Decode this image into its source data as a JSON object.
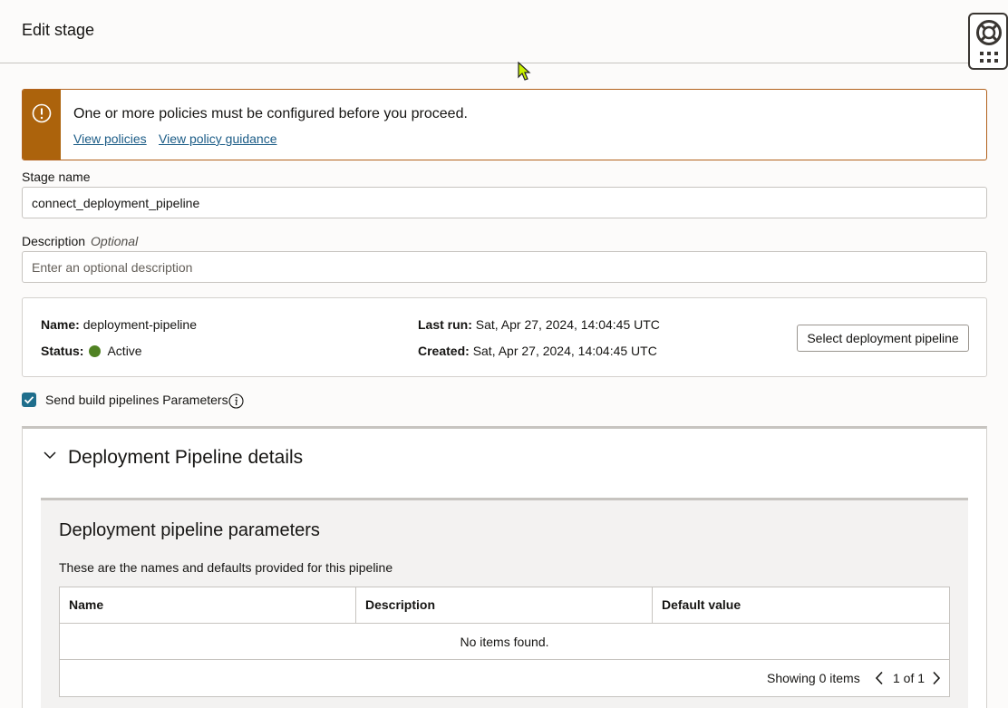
{
  "header": {
    "title": "Edit stage"
  },
  "help_widget": {
    "icon": "lifebuoy-icon",
    "menu_icon": "apps-grid-icon"
  },
  "alert": {
    "message": "One or more policies must be configured before you proceed.",
    "links": [
      "View policies",
      "View policy guidance"
    ],
    "color": "#ac630c"
  },
  "form": {
    "stage_name_label": "Stage name",
    "stage_name_value": "connect_deployment_pipeline",
    "description_label": "Description",
    "description_optional": "Optional",
    "description_placeholder": "Enter an optional description"
  },
  "pipeline": {
    "name_label": "Name:",
    "name_value": "deployment-pipeline",
    "status_label": "Status:",
    "status_value": "Active",
    "status_color": "#508223",
    "last_run_label": "Last run:",
    "last_run_value": "Sat, Apr 27, 2024, 14:04:45 UTC",
    "created_label": "Created:",
    "created_value": "Sat, Apr 27, 2024, 14:04:45 UTC",
    "select_button": "Select deployment pipeline"
  },
  "send_params": {
    "label": "Send build pipelines Parameters",
    "checked": true
  },
  "details": {
    "title": "Deployment Pipeline details",
    "params_title": "Deployment pipeline parameters",
    "params_desc": "These are the names and defaults provided for this pipeline",
    "columns": [
      "Name",
      "Description",
      "Default value"
    ],
    "empty": "No items found.",
    "showing": "Showing 0 items",
    "page": "1 of 1"
  }
}
